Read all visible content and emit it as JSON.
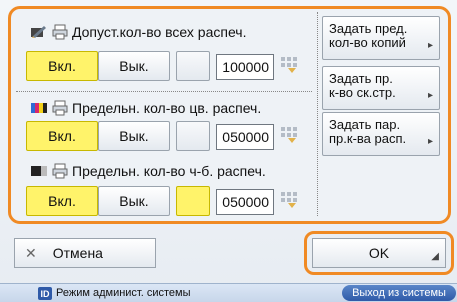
{
  "rows": [
    {
      "title": "Допуст.кол-во всех распеч.",
      "on_label": "Вкл.",
      "off_label": "Вык.",
      "value": "100000",
      "icon": "pencil-icon"
    },
    {
      "title": "Предельн. кол-во цв. распеч.",
      "on_label": "Вкл.",
      "off_label": "Вык.",
      "value": "050000",
      "icon": "color-bars-icon"
    },
    {
      "title": "Предельн. кол-во ч-б. распеч.",
      "on_label": "Вкл.",
      "off_label": "Вык.",
      "value": "050000",
      "icon": "black-white-icon"
    }
  ],
  "side_buttons": [
    {
      "line1": "Задать пред.",
      "line2": "кол-во копий"
    },
    {
      "line1": "Задать пр.",
      "line2": "к-во ск.стр."
    },
    {
      "line1": "Задать пар.",
      "line2": "пр.к-ва расп."
    }
  ],
  "cancel_label": "Отмена",
  "ok_label": "OK",
  "status": {
    "badge": "ID",
    "text": "Режим админист. системы",
    "logout_label": "Выход из системы"
  },
  "colors": {
    "accent_border": "#f08a24",
    "on_state": "#fff36a",
    "status_badge": "#2f5aa8"
  }
}
